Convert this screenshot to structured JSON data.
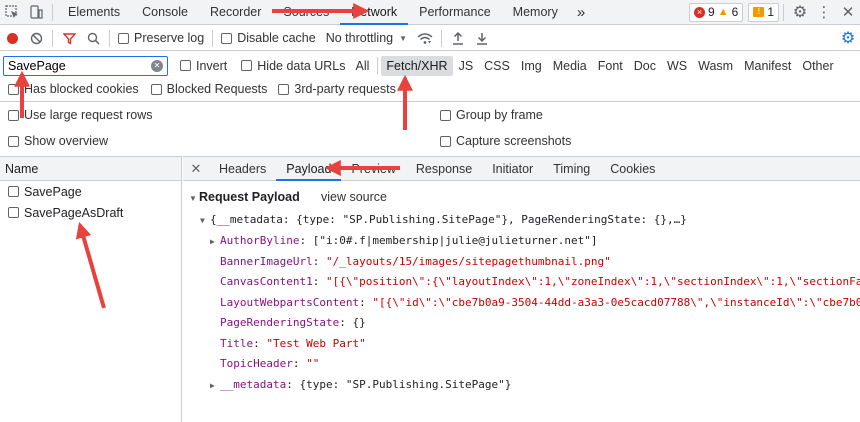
{
  "top_tabs": {
    "tabs": [
      {
        "label": "Elements"
      },
      {
        "label": "Console"
      },
      {
        "label": "Recorder"
      },
      {
        "label": "Sources"
      },
      {
        "label": "Network"
      },
      {
        "label": "Performance"
      },
      {
        "label": "Memory"
      }
    ],
    "more": "»",
    "errors": "9",
    "warnings": "6",
    "issues": "1"
  },
  "toolbar": {
    "preserve_log": "Preserve log",
    "disable_cache": "Disable cache",
    "throttling": "No throttling"
  },
  "filter": {
    "value": "SavePage",
    "invert": "Invert",
    "hide_data_urls": "Hide data URLs",
    "types": [
      "All",
      "Fetch/XHR",
      "JS",
      "CSS",
      "Img",
      "Media",
      "Font",
      "Doc",
      "WS",
      "Wasm",
      "Manifest",
      "Other"
    ],
    "active_type": "Fetch/XHR"
  },
  "options": {
    "has_blocked_cookies": "Has blocked cookies",
    "blocked_requests": "Blocked Requests",
    "third_party": "3rd-party requests",
    "large_rows": "Use large request rows",
    "group_by_frame": "Group by frame",
    "show_overview": "Show overview",
    "capture_screenshots": "Capture screenshots"
  },
  "requests": {
    "header": "Name",
    "items": [
      {
        "name": "SavePage"
      },
      {
        "name": "SavePageAsDraft"
      }
    ]
  },
  "detail": {
    "tabs": [
      "Headers",
      "Payload",
      "Preview",
      "Response",
      "Initiator",
      "Timing",
      "Cookies"
    ],
    "active_tab": "Payload",
    "section_title": "Request Payload",
    "view_source": "view source",
    "summary": "{__metadata: {type: \"SP.Publishing.SitePage\"}, PageRenderingState: {},…}",
    "fields": [
      {
        "key": "AuthorByline",
        "value": "[\"i:0#.f|membership|julie@julieturner.net\"]",
        "kind": "plain",
        "expandable": true
      },
      {
        "key": "BannerImageUrl",
        "value": "\"/_layouts/15/images/sitepagethumbnail.png\"",
        "kind": "str",
        "expandable": false
      },
      {
        "key": "CanvasContent1",
        "value": "\"[{\\\"position\\\":{\\\"layoutIndex\\\":1,\\\"zoneIndex\\\":1,\\\"sectionIndex\\\":1,\\\"sectionFac",
        "kind": "str",
        "expandable": false
      },
      {
        "key": "LayoutWebpartsContent",
        "value": "\"[{\\\"id\\\":\\\"cbe7b0a9-3504-44dd-a3a3-0e5cacd07788\\\",\\\"instanceId\\\":\\\"cbe7b0",
        "kind": "str",
        "expandable": false
      },
      {
        "key": "PageRenderingState",
        "value": "{}",
        "kind": "plain",
        "expandable": false
      },
      {
        "key": "Title",
        "value": "\"Test Web Part\"",
        "kind": "str",
        "expandable": false
      },
      {
        "key": "TopicHeader",
        "value": "\"\"",
        "kind": "str",
        "expandable": false
      },
      {
        "key": "__metadata",
        "value": "{type: \"SP.Publishing.SitePage\"}",
        "kind": "plain",
        "expandable": true
      }
    ]
  },
  "colors": {
    "arrow": "#e8423f",
    "accent": "#1a73e8",
    "error": "#d93025",
    "warning": "#f29900",
    "issue": "#f29900",
    "key": "#881280",
    "string": "#c80000"
  }
}
